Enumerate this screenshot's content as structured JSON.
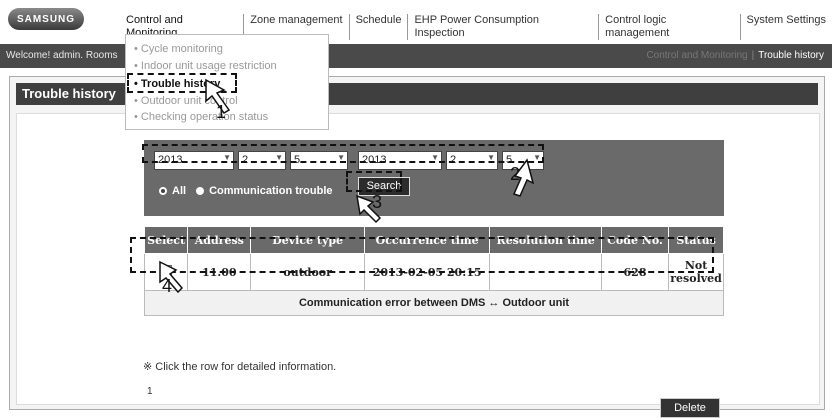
{
  "brand": "SAMSUNG",
  "top_nav": [
    "Control and Monitoring",
    "Zone management",
    "Schedule",
    "EHP Power Consumption Inspection",
    "Control logic management",
    "System Settings"
  ],
  "menu": {
    "items": [
      "Cycle monitoring",
      "Indoor unit usage restriction",
      "Trouble history",
      "Outdoor unit control",
      "Checking operation status"
    ]
  },
  "welcome_text": "Welcome! admin. Rooms",
  "breadcrumb": {
    "parent": "Control and Monitoring",
    "current": "Trouble history"
  },
  "page_title": "Trouble history",
  "filter": {
    "from": {
      "year": "2013",
      "month": "2",
      "day": "5"
    },
    "to": {
      "year": "2013",
      "month": "2",
      "day": "5"
    },
    "radio_all": "All",
    "radio_comm": "Communication trouble",
    "search_label": "Search"
  },
  "table": {
    "headers": [
      "Select",
      "Address",
      "Device type",
      "Occurrence time",
      "Resolution time",
      "Code No.",
      "Status"
    ],
    "row": {
      "address": "11.00",
      "device_type": "outdoor",
      "occurrence_time": "2013-02-05 20:15",
      "resolution_time": "",
      "code_no": "628",
      "status": "Not resolved"
    },
    "detail": "Communication error between DMS ↔ Outdoor unit"
  },
  "note": "※ Click the row for detailed information.",
  "page_number": "1",
  "delete_label": "Delete",
  "callouts": [
    "1",
    "2",
    "3",
    "4"
  ],
  "colors": {
    "header_dark": "#3f3f3f",
    "table_header": "#6a6a6a"
  }
}
